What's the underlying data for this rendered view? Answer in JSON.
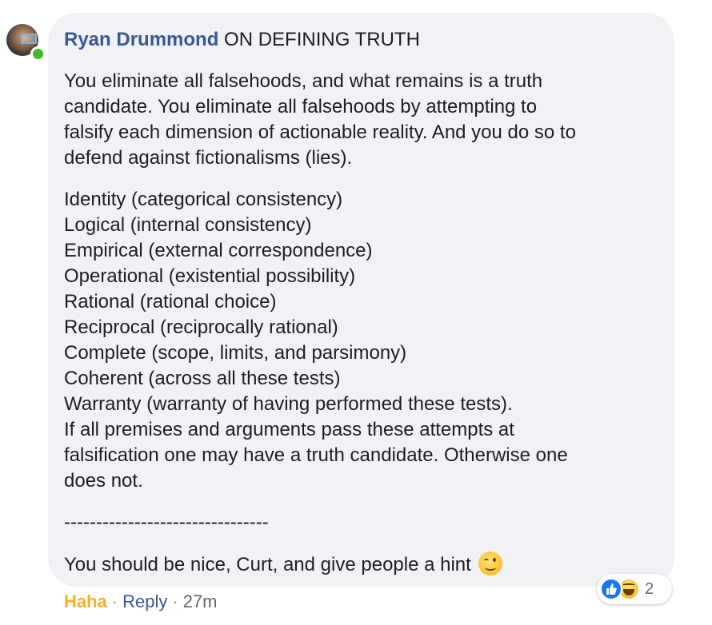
{
  "comment": {
    "author": "Ryan Drummond",
    "title": "ON DEFINING TRUTH",
    "intro_lines": [
      "You eliminate all falsehoods, and what remains is a truth",
      "candidate. You eliminate all falsehoods by attempting to",
      "falsify each dimension of actionable reality. And you do so to",
      "defend against fictionalisms (lies)."
    ],
    "list_lines": [
      "Identity (categorical consistency)",
      "Logical (internal consistency)",
      "Empirical (external correspondence)",
      "Operational (existential possibility)",
      "Rational (rational choice)",
      "Reciprocal (reciprocally rational)",
      "Complete (scope, limits, and parsimony)",
      "Coherent (across all these tests)",
      "Warranty (warranty of having performed these tests).",
      "If all premises and arguments pass these attempts at",
      "falsification one may have a truth candidate. Otherwise one",
      "does not."
    ],
    "divider": "--------------------------------",
    "closing": "You should be nice, Curt, and give people a hint",
    "closing_emoji": "wink-emoji"
  },
  "reactions": {
    "icons": [
      "like-icon",
      "haha-icon"
    ],
    "count": "2"
  },
  "actions": {
    "haha_label": "Haha",
    "separator": "·",
    "reply_label": "Reply",
    "time": "27m"
  },
  "colors": {
    "author": "#385898",
    "bubble": "#f0f2f5",
    "haha": "#f7b125",
    "online": "#42b72a",
    "like": "#1877f2"
  }
}
